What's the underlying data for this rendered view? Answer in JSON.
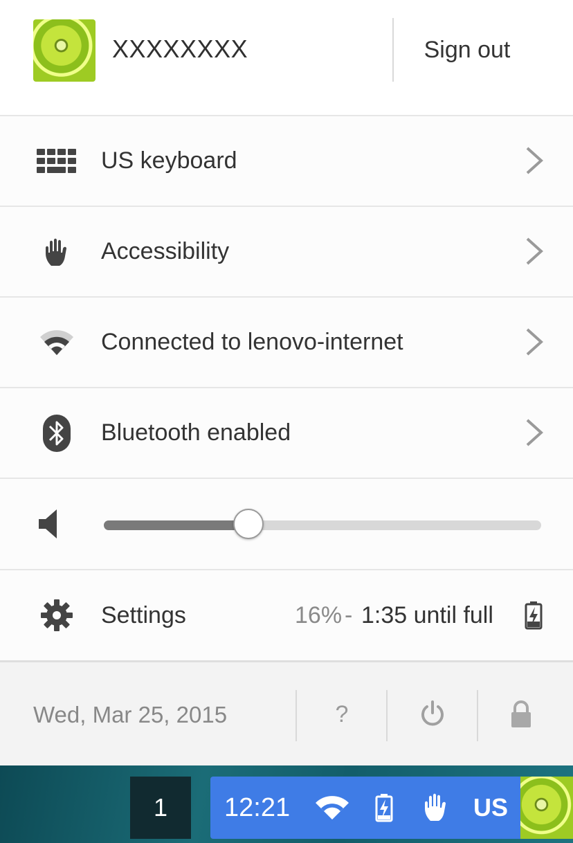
{
  "header": {
    "user_name": "XXXXXXXX",
    "sign_out_label": "Sign out"
  },
  "menu": [
    {
      "label": "US keyboard",
      "icon": "keyboard-icon"
    },
    {
      "label": "Accessibility",
      "icon": "hand-icon"
    },
    {
      "label": "Connected to lenovo-internet",
      "icon": "wifi-icon"
    },
    {
      "label": "Bluetooth enabled",
      "icon": "bluetooth-icon"
    }
  ],
  "volume": {
    "icon": "speaker-icon",
    "level": 0.33
  },
  "settings_row": {
    "label": "Settings",
    "battery_percent": "16%",
    "separator": "-",
    "battery_time": "1:35 until full"
  },
  "footer": {
    "date": "Wed, Mar 25, 2015",
    "help_label": "?"
  },
  "shelf": {
    "window_count": "1",
    "time": "12:21",
    "input_method": "US"
  },
  "colors": {
    "tray_blue": "#3f7ce6",
    "panel_bg": "#fcfcfc",
    "footer_bg": "#f3f3f3"
  }
}
